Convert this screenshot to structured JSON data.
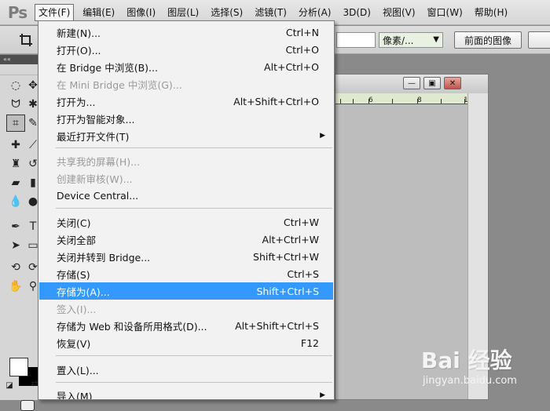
{
  "app": {
    "logo": "Ps",
    "menus": [
      "文件(F)",
      "编辑(E)",
      "图像(I)",
      "图层(L)",
      "选择(S)",
      "滤镜(T)",
      "分析(A)",
      "3D(D)",
      "视图(V)",
      "窗口(W)",
      "帮助(H)"
    ],
    "active_menu_index": 0
  },
  "options_bar": {
    "units_select": "像素/...",
    "front_image_button": "前面的图像"
  },
  "document": {
    "ruler_ticks": [
      "6",
      "8",
      "10"
    ]
  },
  "file_menu": {
    "items": [
      {
        "label": "新建(N)...",
        "shortcut": "Ctrl+N",
        "disabled": false
      },
      {
        "label": "打开(O)...",
        "shortcut": "Ctrl+O",
        "disabled": false
      },
      {
        "label": "在 Bridge 中浏览(B)...",
        "shortcut": "Alt+Ctrl+O",
        "disabled": false
      },
      {
        "label": "在 Mini Bridge 中浏览(G)...",
        "shortcut": "",
        "disabled": true
      },
      {
        "label": "打开为...",
        "shortcut": "Alt+Shift+Ctrl+O",
        "disabled": false
      },
      {
        "label": "打开为智能对象...",
        "shortcut": "",
        "disabled": false
      },
      {
        "label": "最近打开文件(T)",
        "shortcut": "",
        "disabled": false,
        "submenu": true
      },
      {
        "label": "共享我的屏幕(H)...",
        "shortcut": "",
        "disabled": true
      },
      {
        "label": "创建新审核(W)...",
        "shortcut": "",
        "disabled": true
      },
      {
        "label": "Device Central...",
        "shortcut": "",
        "disabled": false
      },
      {
        "label": "关闭(C)",
        "shortcut": "Ctrl+W",
        "disabled": false
      },
      {
        "label": "关闭全部",
        "shortcut": "Alt+Ctrl+W",
        "disabled": false
      },
      {
        "label": "关闭并转到 Bridge...",
        "shortcut": "Shift+Ctrl+W",
        "disabled": false
      },
      {
        "label": "存储(S)",
        "shortcut": "Ctrl+S",
        "disabled": false
      },
      {
        "label": "存储为(A)...",
        "shortcut": "Shift+Ctrl+S",
        "disabled": false,
        "highlighted": true
      },
      {
        "label": "签入(I)...",
        "shortcut": "",
        "disabled": true
      },
      {
        "label": "存储为 Web 和设备所用格式(D)...",
        "shortcut": "Alt+Shift+Ctrl+S",
        "disabled": false
      },
      {
        "label": "恢复(V)",
        "shortcut": "F12",
        "disabled": false
      },
      {
        "label": "置入(L)...",
        "shortcut": "",
        "disabled": false
      },
      {
        "label": "导入(M)",
        "shortcut": "",
        "disabled": false,
        "submenu": true
      }
    ]
  },
  "colors": {
    "highlight": "#3399ff",
    "disabled_text": "#9a9a9a"
  },
  "watermark": {
    "main": "Bai 经验",
    "sub": "jingyan.baidu.com"
  }
}
